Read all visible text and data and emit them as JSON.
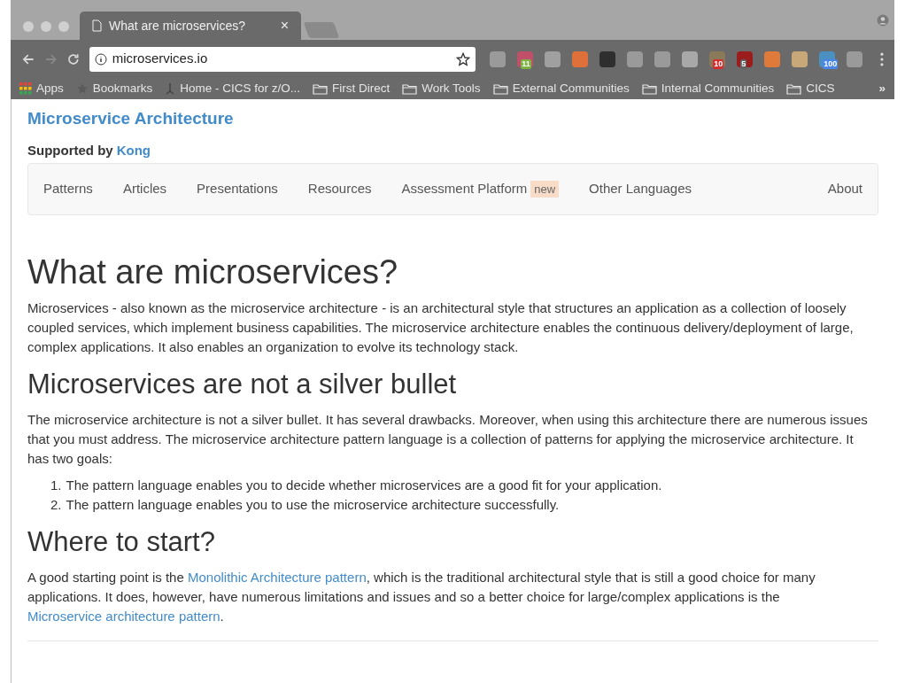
{
  "browser": {
    "tab": {
      "title": "What are microservices?",
      "close": "×"
    },
    "address": "microservices.io",
    "extensions": [
      {
        "color": "#9a9a9a"
      },
      {
        "color": "#c0506a",
        "badge": {
          "text": "11",
          "color": "#7cb342"
        }
      },
      {
        "color": "#a0a0a0"
      },
      {
        "color": "#e0703a"
      },
      {
        "color": "#2e2e2e"
      },
      {
        "color": "#9a9a9a"
      },
      {
        "color": "#9a9a9a"
      },
      {
        "color": "#a8a8a8"
      },
      {
        "color": "#8a7a5a",
        "badge": {
          "text": "10",
          "color": "#d32f2f"
        }
      },
      {
        "color": "#9b1c1c",
        "badge": {
          "text": "5",
          "color": "#616161"
        }
      },
      {
        "color": "#e07a3a"
      },
      {
        "color": "#c8a878"
      },
      {
        "color": "#4a90c0",
        "badge": {
          "text": "100",
          "color": "#4a86e8"
        }
      },
      {
        "color": "#9a9a9a"
      }
    ],
    "bookmarks": [
      {
        "kind": "apps",
        "label": "Apps"
      },
      {
        "kind": "star",
        "label": "Bookmarks"
      },
      {
        "kind": "page",
        "label": "Home - CICS for z/O..."
      },
      {
        "kind": "folder",
        "label": "First Direct"
      },
      {
        "kind": "folder",
        "label": "Work Tools"
      },
      {
        "kind": "folder",
        "label": "External Communities"
      },
      {
        "kind": "folder",
        "label": "Internal Communities"
      },
      {
        "kind": "folder",
        "label": "CICS"
      }
    ],
    "more": "»"
  },
  "site": {
    "title": "Microservice Architecture",
    "supported": "Supported by",
    "sponsor": "Kong",
    "nav": [
      {
        "label": "Patterns"
      },
      {
        "label": "Articles"
      },
      {
        "label": "Presentations"
      },
      {
        "label": "Resources"
      },
      {
        "label": "Assessment Platform",
        "badge": "new"
      },
      {
        "label": "Other Languages"
      },
      {
        "label": "About"
      }
    ]
  },
  "content": [
    {
      "kind": "h1",
      "text": "What are microservices?"
    },
    {
      "kind": "p",
      "parts": [
        {
          "text": "Microservices - also known as the microservice architecture - is an architectural style that structures an application as a collection of loosely coupled services, which implement business capabilities. The microservice architecture enables the continuous delivery/deployment of large, complex applications. It also enables an organization to evolve its technology stack."
        }
      ]
    },
    {
      "kind": "h2",
      "text": "Microservices are not a silver bullet"
    },
    {
      "kind": "p",
      "parts": [
        {
          "text": "The microservice architecture is not a silver bullet. It has several drawbacks. Moreover, when using this architecture there are numerous issues that you must address. The microservice architecture pattern language is a collection of patterns for applying the microservice architecture. It has two goals:"
        }
      ]
    },
    {
      "kind": "ol",
      "items": [
        {
          "num": "1.",
          "text": "The pattern language enables you to decide whether microservices are a good fit for your application."
        },
        {
          "num": "2.",
          "text": "The pattern language enables you to use the microservice architecture successfully."
        }
      ]
    },
    {
      "kind": "h2",
      "text": "Where to start?"
    },
    {
      "kind": "p",
      "parts": [
        {
          "text": "A good starting point is the "
        },
        {
          "text": "Monolithic Architecture pattern",
          "link": true
        },
        {
          "text": ", which is the traditional architectural style that is still a good choice for many applications. It does, however, have numerous limitations and issues and so a better choice for large/complex applications is the "
        },
        {
          "text": "Microservice architecture pattern",
          "link": true
        },
        {
          "text": "."
        }
      ]
    }
  ]
}
